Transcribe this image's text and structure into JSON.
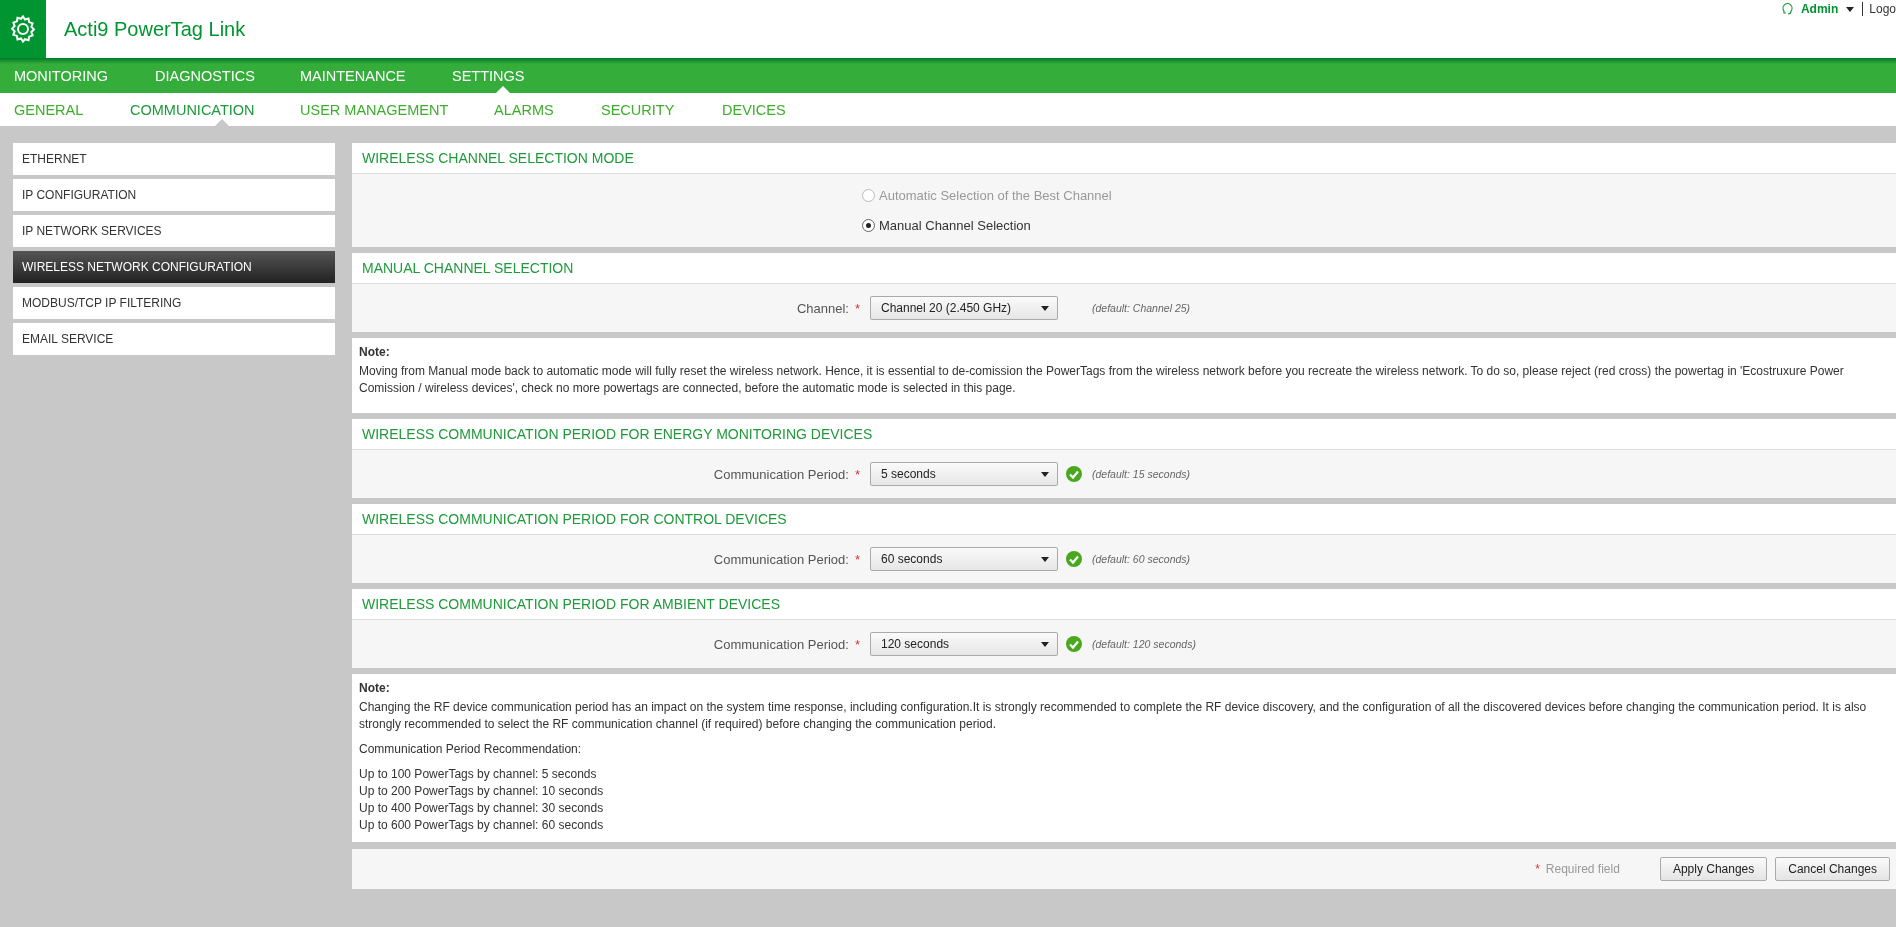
{
  "app": {
    "title": "Acti9 PowerTag Link"
  },
  "user": {
    "name": "Admin",
    "logout": "Logo"
  },
  "main_nav": [
    {
      "label": "MONITORING",
      "selected": false
    },
    {
      "label": "DIAGNOSTICS",
      "selected": false
    },
    {
      "label": "MAINTENANCE",
      "selected": false
    },
    {
      "label": "SETTINGS",
      "selected": true
    }
  ],
  "sub_nav": [
    {
      "label": "GENERAL",
      "selected": false
    },
    {
      "label": "COMMUNICATION",
      "selected": true
    },
    {
      "label": "USER MANAGEMENT",
      "selected": false
    },
    {
      "label": "ALARMS",
      "selected": false
    },
    {
      "label": "SECURITY",
      "selected": false
    },
    {
      "label": "DEVICES",
      "selected": false
    }
  ],
  "sidebar": {
    "items": [
      {
        "label": "ETHERNET",
        "selected": false
      },
      {
        "label": "IP CONFIGURATION",
        "selected": false
      },
      {
        "label": "IP NETWORK SERVICES",
        "selected": false
      },
      {
        "label": "WIRELESS NETWORK CONFIGURATION",
        "selected": true
      },
      {
        "label": "MODBUS/TCP IP FILTERING",
        "selected": false
      },
      {
        "label": "EMAIL SERVICE",
        "selected": false
      }
    ]
  },
  "sections": [
    {
      "kind": "radio",
      "title": "WIRELESS CHANNEL SELECTION MODE",
      "options": [
        {
          "label": "Automatic Selection of the Best Channel",
          "selected": false,
          "disabled": true
        },
        {
          "label": "Manual Channel Selection",
          "selected": true,
          "disabled": false
        }
      ]
    },
    {
      "kind": "select",
      "title": "MANUAL CHANNEL SELECTION",
      "label": "Channel:",
      "required_mark": "*",
      "value": "Channel 20 (2.450 GHz)",
      "valid": false,
      "hint": "(default: Channel 25)"
    },
    {
      "kind": "note",
      "heading": "Note:",
      "paragraphs": [
        "Moving from Manual mode back to automatic mode will fully reset the wireless network. Hence, it is essential to de-comission the PowerTags from the wireless network before you recreate the wireless network. To do so, please reject (red cross) the powertag in 'Ecostruxure Power Comission / wireless devices', check no more powertags are connected, before the automatic mode is selected in this page."
      ]
    },
    {
      "kind": "select",
      "title": "WIRELESS COMMUNICATION PERIOD FOR ENERGY MONITORING DEVICES",
      "label": "Communication Period:",
      "required_mark": "*",
      "value": "5 seconds",
      "valid": true,
      "hint": "(default: 15 seconds)"
    },
    {
      "kind": "select",
      "title": "WIRELESS COMMUNICATION PERIOD FOR CONTROL DEVICES",
      "label": "Communication Period:",
      "required_mark": "*",
      "value": "60 seconds",
      "valid": true,
      "hint": "(default: 60 seconds)"
    },
    {
      "kind": "select",
      "title": "WIRELESS COMMUNICATION PERIOD FOR AMBIENT DEVICES",
      "label": "Communication Period:",
      "required_mark": "*",
      "value": "120 seconds",
      "valid": true,
      "hint": "(default: 120 seconds)"
    },
    {
      "kind": "note",
      "heading": "Note:",
      "paragraphs": [
        "Changing the RF device communication period has an impact on the system time response, including configuration.It is strongly recommended to complete the RF device discovery, and the configuration of all the discovered devices before changing the communication period. It is also strongly recommended to select the RF communication channel (if required) before changing the communication period.",
        "Communication Period Recommendation:"
      ],
      "lines": [
        "Up to 100 PowerTags by channel: 5 seconds",
        "Up to 200 PowerTags by channel: 10 seconds",
        "Up to 400 PowerTags by channel: 30 seconds",
        "Up to 600 PowerTags by channel: 60 seconds"
      ]
    }
  ],
  "footer": {
    "required_mark": "*",
    "required_text": "Required field",
    "buttons": [
      "Apply Changes",
      "Cancel Changes"
    ]
  }
}
